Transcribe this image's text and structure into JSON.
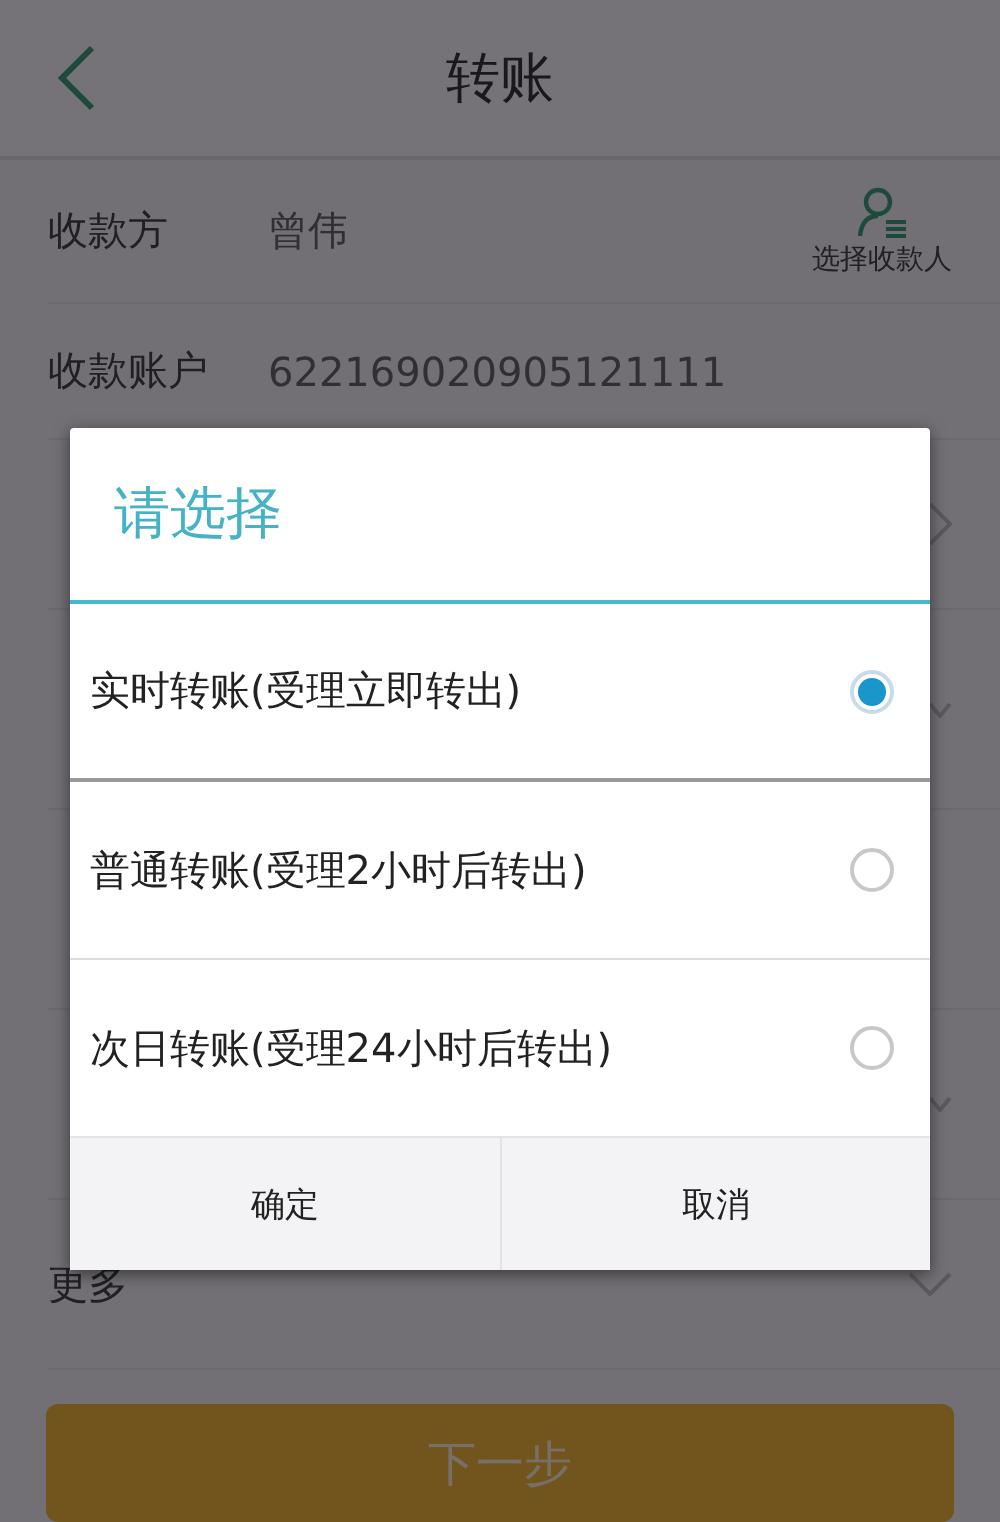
{
  "header": {
    "title": "转账"
  },
  "payee": {
    "label": "收款方",
    "value": "曾伟",
    "action": "选择收款人"
  },
  "account": {
    "label": "收款账户",
    "value": "622169020905121111"
  },
  "hidden_rows": [
    {
      "kind": "select"
    },
    {
      "kind": "dropdown"
    },
    {
      "kind": "input"
    },
    {
      "kind": "dropdown"
    }
  ],
  "more": {
    "label": "更多"
  },
  "next_button": {
    "label": "下一步",
    "disabled": true
  },
  "dialog": {
    "title": "请选择",
    "options": [
      {
        "label": "实时转账(受理立即转出)",
        "selected": true
      },
      {
        "label": "普通转账(受理2小时后转出)",
        "selected": false
      },
      {
        "label": "次日转账(受理24小时后转出)",
        "selected": false
      }
    ],
    "buttons": [
      "确定",
      "取消"
    ]
  }
}
